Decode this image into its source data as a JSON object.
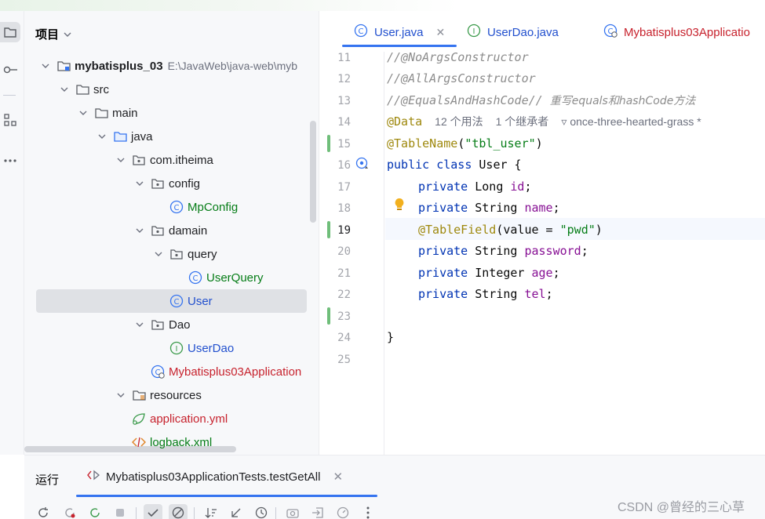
{
  "project_panel": {
    "title": "项目",
    "tree": [
      {
        "label": "mybatisplus_03",
        "path": "E:\\JavaWeb\\java-web\\myb",
        "kind": "module"
      },
      {
        "label": "src",
        "kind": "folder"
      },
      {
        "label": "main",
        "kind": "folder"
      },
      {
        "label": "java",
        "kind": "src-folder"
      },
      {
        "label": "com.itheima",
        "kind": "package"
      },
      {
        "label": "config",
        "kind": "package"
      },
      {
        "label": "MpConfig",
        "kind": "class"
      },
      {
        "label": "damain",
        "kind": "package"
      },
      {
        "label": "query",
        "kind": "package"
      },
      {
        "label": "UserQuery",
        "kind": "class"
      },
      {
        "label": "User",
        "kind": "class"
      },
      {
        "label": "Dao",
        "kind": "package"
      },
      {
        "label": "UserDao",
        "kind": "interface"
      },
      {
        "label": "Mybatisplus03Application",
        "kind": "spring-app"
      },
      {
        "label": "resources",
        "kind": "resources"
      },
      {
        "label": "application.yml",
        "kind": "yml"
      },
      {
        "label": "logback.xml",
        "kind": "xml"
      }
    ]
  },
  "editor": {
    "tabs": [
      {
        "label": "User.java",
        "icon": "class-icon",
        "active": true
      },
      {
        "label": "UserDao.java",
        "icon": "interface-icon"
      },
      {
        "label": "Mybatisplus03Applicatio",
        "icon": "spring-app-icon"
      }
    ],
    "line_numbers": [
      "11",
      "12",
      "13",
      "14",
      "15",
      "16",
      "17",
      "18",
      "19",
      "20",
      "21",
      "22",
      "23",
      "24",
      "25"
    ],
    "current_line": "19",
    "code": {
      "l11": "//@NoArgsConstructor",
      "l12": "//@AllArgsConstructor",
      "l13a": "//@EqualsAndHashCode// ",
      "l13b": "重写equals和hashCode方法",
      "l14_ann": "@Data",
      "l14_usages": "12 个用法",
      "l14_inherit": "1 个继承者",
      "l14_author": "once-three-hearted-grass *",
      "l15_ann": "@TableName",
      "l15_open": "(",
      "l15_str": "\"tbl_user\"",
      "l15_close": ")",
      "l16_kw": "public class",
      "l16_rest": " User {",
      "private": "private",
      "l17_type": " Long ",
      "l17_field": "id",
      "l18_type": " String ",
      "l18_field": "name",
      "l19_ann": "@TableField",
      "l19_mid": "(value = ",
      "l19_str": "\"pwd\"",
      "l19_close": ")",
      "l20_type": " String ",
      "l20_field": "password",
      "l21_type": " Integer ",
      "l21_field": "age",
      "l22_type": " String ",
      "l22_field": "tel",
      "semi": ";",
      "l24": "}"
    }
  },
  "run_panel": {
    "title": "运行",
    "tab_label": "Mybatisplus03ApplicationTests.testGetAll"
  },
  "watermark": "CSDN @曾经的三心草",
  "colors": {
    "accent": "#3574f0",
    "keyword": "#0033b3",
    "annotation": "#9e880d",
    "string": "#067d17",
    "field": "#871094",
    "comment": "#8c8c8c"
  }
}
